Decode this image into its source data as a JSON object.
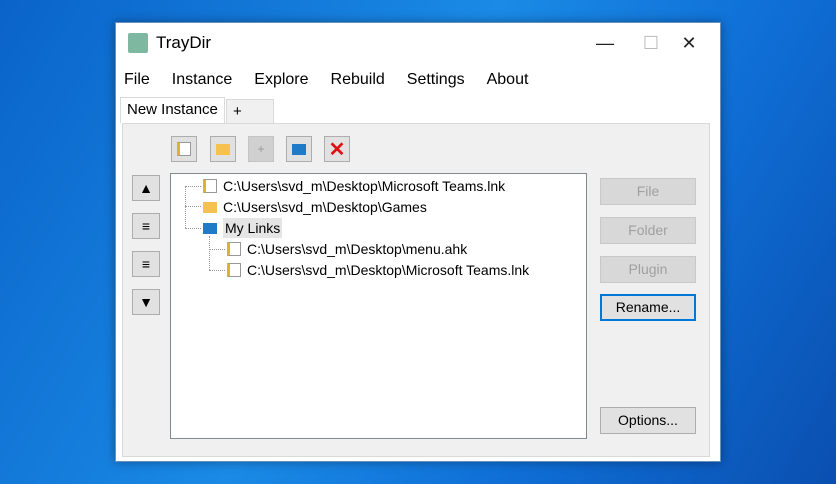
{
  "window": {
    "title": "TrayDir",
    "minimize": "—",
    "maximize": "☐",
    "close": "✕"
  },
  "menu": [
    "File",
    "Instance",
    "Explore",
    "Rebuild",
    "Settings",
    "About"
  ],
  "tabs": {
    "active": "New Instance",
    "add": "+"
  },
  "toolbar": [
    "add-file",
    "add-folder",
    "add-plugin",
    "add-virtual-folder",
    "delete"
  ],
  "tree": [
    {
      "label": "C:\\Users\\svd_m\\Desktop\\Microsoft Teams.lnk",
      "type": "file",
      "level": 0
    },
    {
      "label": "C:\\Users\\svd_m\\Desktop\\Games",
      "type": "folder",
      "level": 0
    },
    {
      "label": "My Links",
      "type": "virtual-folder",
      "level": 0
    },
    {
      "label": "C:\\Users\\svd_m\\Desktop\\menu.ahk",
      "type": "file",
      "level": 1
    },
    {
      "label": "C:\\Users\\svd_m\\Desktop\\Microsoft Teams.lnk",
      "type": "file",
      "level": 1
    }
  ],
  "buttons": {
    "file": "File",
    "folder": "Folder",
    "plugin": "Plugin",
    "rename": "Rename...",
    "options": "Options..."
  }
}
